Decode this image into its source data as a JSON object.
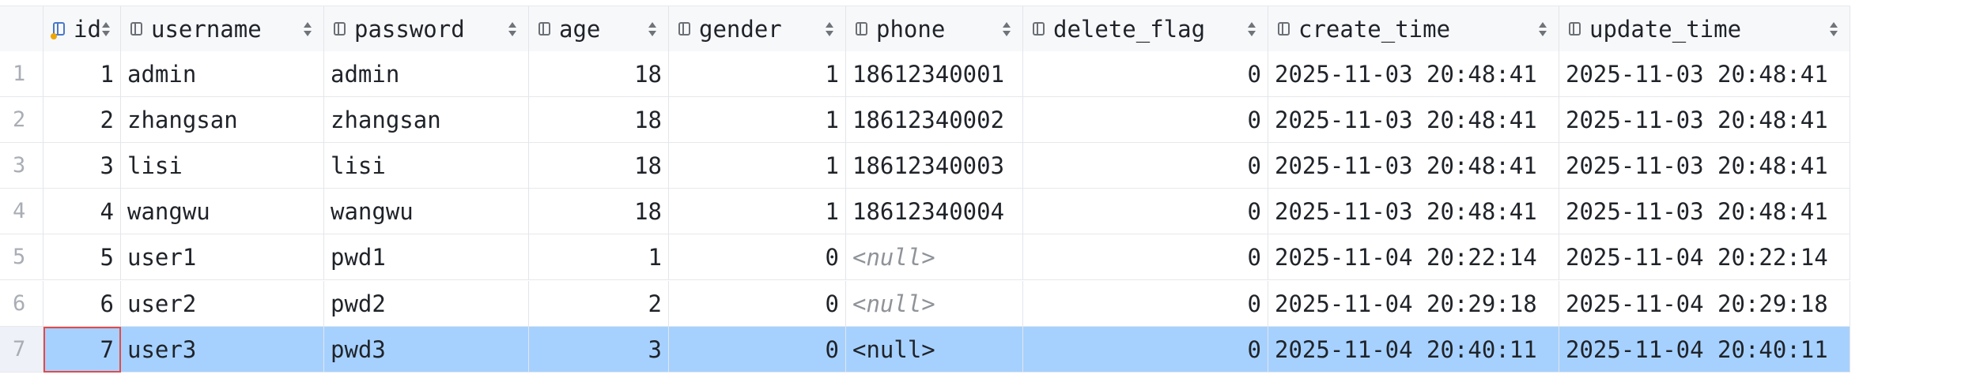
{
  "grid": {
    "columns": [
      {
        "name": "id",
        "icon": "primary-key-column-icon",
        "type": "key",
        "align": "right"
      },
      {
        "name": "username",
        "icon": "column-icon",
        "type": "column",
        "align": "left"
      },
      {
        "name": "password",
        "icon": "column-icon",
        "type": "column",
        "align": "left"
      },
      {
        "name": "age",
        "icon": "column-icon",
        "type": "column",
        "align": "right"
      },
      {
        "name": "gender",
        "icon": "column-icon",
        "type": "column",
        "align": "right"
      },
      {
        "name": "phone",
        "icon": "column-icon",
        "type": "column",
        "align": "left"
      },
      {
        "name": "delete_flag",
        "icon": "column-icon",
        "type": "column",
        "align": "right"
      },
      {
        "name": "create_time",
        "icon": "column-icon",
        "type": "column",
        "align": "left"
      },
      {
        "name": "update_time",
        "icon": "column-icon",
        "type": "column",
        "align": "left"
      }
    ],
    "rows": [
      {
        "row_num": "1",
        "cells": [
          "1",
          "admin",
          "admin",
          "18",
          "1",
          "18612340001",
          "0",
          "2025-11-03 20:48:41",
          "2025-11-03 20:48:41"
        ]
      },
      {
        "row_num": "2",
        "cells": [
          "2",
          "zhangsan",
          "zhangsan",
          "18",
          "1",
          "18612340002",
          "0",
          "2025-11-03 20:48:41",
          "2025-11-03 20:48:41"
        ]
      },
      {
        "row_num": "3",
        "cells": [
          "3",
          "lisi",
          "lisi",
          "18",
          "1",
          "18612340003",
          "0",
          "2025-11-03 20:48:41",
          "2025-11-03 20:48:41"
        ]
      },
      {
        "row_num": "4",
        "cells": [
          "4",
          "wangwu",
          "wangwu",
          "18",
          "1",
          "18612340004",
          "0",
          "2025-11-03 20:48:41",
          "2025-11-03 20:48:41"
        ]
      },
      {
        "row_num": "5",
        "cells": [
          "5",
          "user1",
          "pwd1",
          "1",
          "0",
          "<null>",
          "0",
          "2025-11-04 20:22:14",
          "2025-11-04 20:22:14"
        ]
      },
      {
        "row_num": "6",
        "cells": [
          "6",
          "user2",
          "pwd2",
          "2",
          "0",
          "<null>",
          "0",
          "2025-11-04 20:29:18",
          "2025-11-04 20:29:18"
        ]
      },
      {
        "row_num": "7",
        "cells": [
          "7",
          "user3",
          "pwd3",
          "3",
          "0",
          "<null>",
          "0",
          "2025-11-04 20:40:11",
          "2025-11-04 20:40:11"
        ]
      }
    ],
    "selected_row": "7",
    "focused_cell": "id"
  },
  "colors": {
    "selection": "#a6d1ff",
    "focus_outline": "#e24a4a",
    "header_bg": "#f7f8fa",
    "null_text": "#8f9399"
  }
}
